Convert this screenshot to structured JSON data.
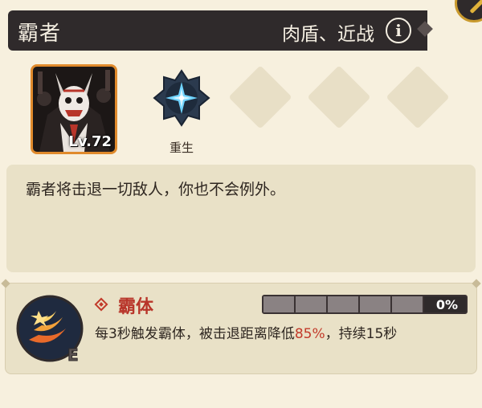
{
  "header": {
    "hero_name": "霸者",
    "roles": "肉盾、近战",
    "info_label": "i"
  },
  "portrait": {
    "level": "Lv.72"
  },
  "rebirth": {
    "label": "重生"
  },
  "description": {
    "text": "霸者将击退一切敌人，你也不会例外。"
  },
  "skill": {
    "name": "霸体",
    "progress_text": "0%",
    "progress_value": 0,
    "desc_before": "每3秒触发霸体，被击退距离降低",
    "desc_highlight": "85%",
    "desc_after": "，持续15秒",
    "icon_letter": "E"
  },
  "colors": {
    "header_bg": "#2f2a2b",
    "page_bg": "#f7f0de",
    "panel_bg": "#e9e1c7",
    "accent_red": "#c23a2a",
    "portrait_border": "#e08a2c"
  }
}
